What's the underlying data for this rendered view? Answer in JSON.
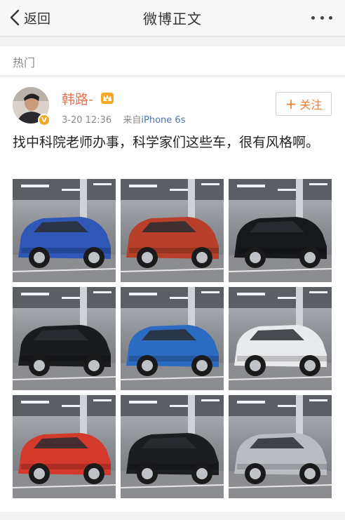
{
  "navbar": {
    "back_label": "返回",
    "title": "微博正文"
  },
  "section": {
    "label": "热门"
  },
  "post": {
    "username": "韩路-",
    "time": "3-20 12:36",
    "source_prefix": "来自",
    "source": "iPhone 6s",
    "follow_label": "关注",
    "text": "找中科院老师办事，科学家们这些车，很有风格啊。",
    "photos": [
      {
        "car": "blue sedan",
        "color": "#2f57b8"
      },
      {
        "car": "red coupe SUV",
        "color": "#b8402a"
      },
      {
        "car": "black SUV",
        "color": "#17181b"
      },
      {
        "car": "black SUV",
        "color": "#1a1b1e"
      },
      {
        "car": "blue SUV",
        "color": "#2b6bc2"
      },
      {
        "car": "white coupe SUV",
        "color": "#e9eaec"
      },
      {
        "car": "red hatchback",
        "color": "#d33a2c"
      },
      {
        "car": "black SUV",
        "color": "#1c1d20"
      },
      {
        "car": "silver wagon",
        "color": "#b9bcc1"
      }
    ]
  }
}
